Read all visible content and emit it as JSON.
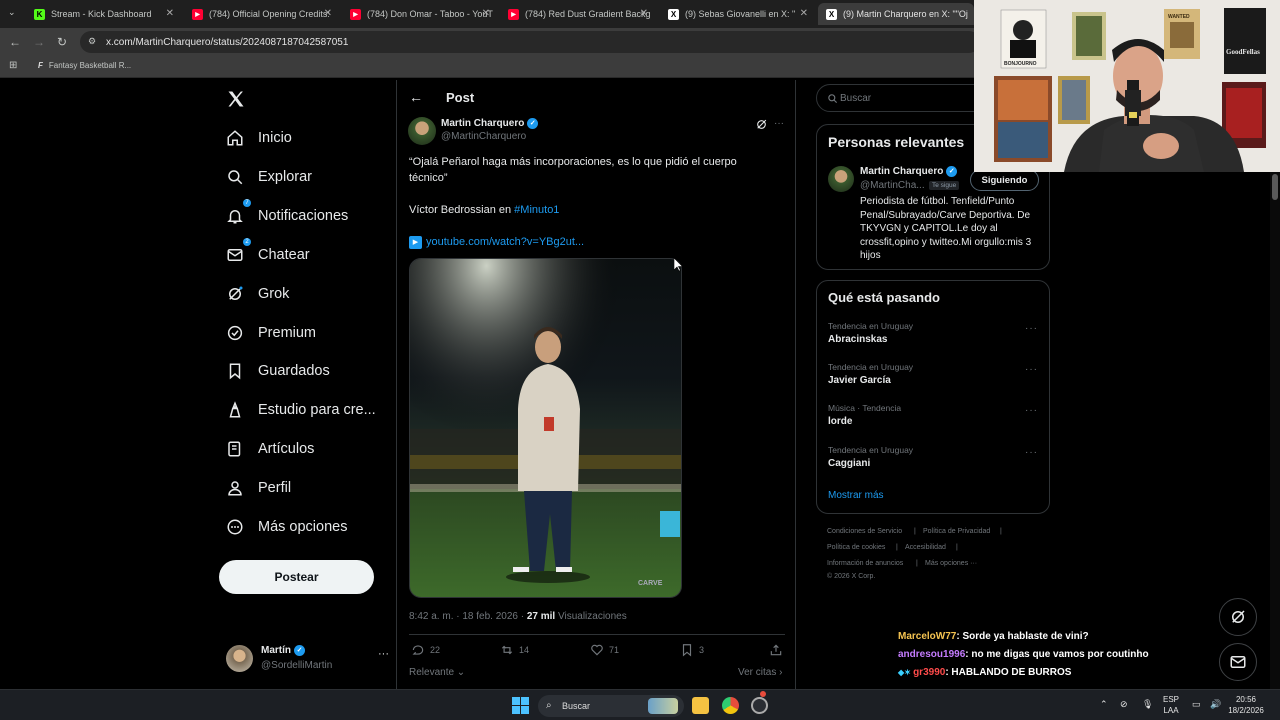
{
  "browser": {
    "tabs": [
      {
        "label": "Stream - Kick Dashboard",
        "favicon": "kick-icon",
        "color": "#53fc18",
        "glyph": "K"
      },
      {
        "label": "(784) Official Opening Credits: ",
        "favicon": "youtube-icon",
        "color": "#ff0033",
        "glyph": "▶"
      },
      {
        "label": "(784) Don Omar - Taboo - YouT",
        "favicon": "youtube-icon",
        "color": "#ff0033",
        "glyph": "▶"
      },
      {
        "label": "(784) Red Dust Gradient Backg",
        "favicon": "youtube-icon",
        "color": "#ff0033",
        "glyph": "▶"
      },
      {
        "label": "(9) Sebas Giovanelli en X: \"",
        "favicon": "x-icon",
        "color": "#ffffff",
        "glyph": "X"
      },
      {
        "label": "(9) Martin Charquero en X: \"\"Oj",
        "favicon": "x-icon",
        "color": "#ffffff",
        "glyph": "X"
      }
    ],
    "url": "x.com/MartinCharquero/status/2024087187042587051",
    "bookmark": "Fantasy Basketball R..."
  },
  "nav": {
    "items": [
      {
        "label": "Inicio",
        "icon": "home-icon"
      },
      {
        "label": "Explorar",
        "icon": "search-icon"
      },
      {
        "label": "Notificaciones",
        "icon": "bell-icon",
        "badge": "7"
      },
      {
        "label": "Chatear",
        "icon": "mail-icon",
        "badge": "2"
      },
      {
        "label": "Grok",
        "icon": "grok-icon"
      },
      {
        "label": "Premium",
        "icon": "premium-icon"
      },
      {
        "label": "Guardados",
        "icon": "bookmark-icon"
      },
      {
        "label": "Estudio para cre...",
        "icon": "studio-icon"
      },
      {
        "label": "Artículos",
        "icon": "article-icon"
      },
      {
        "label": "Perfil",
        "icon": "person-icon"
      },
      {
        "label": "Más opciones",
        "icon": "more-icon"
      }
    ],
    "post_button": "Postear",
    "account": {
      "name": "Martín",
      "handle": "@SordelliMartin"
    }
  },
  "post": {
    "header": "Post",
    "author": {
      "name": "Martin Charquero",
      "handle": "@MartinCharquero"
    },
    "text_line1": "“Ojalá Peñarol haga más incorporaciones, es lo que pidió el cuerpo",
    "text_line2": "técnico”",
    "text_line3_prefix": "Víctor Bedrossian en ",
    "hashtag": "#Minuto1",
    "link": "youtube.com/watch?v=YBg2ut...",
    "photo_watermark": "CARVE",
    "time": "8:42 a. m. · 18 feb. 2026 · ",
    "views_count": "27 mil",
    "views_label": " Visualizaciones",
    "replies": "22",
    "reposts": "14",
    "likes": "71",
    "bookmarks": "3",
    "sort_label": "Relevante",
    "quotes_label": "Ver citas"
  },
  "search": {
    "placeholder": "Buscar"
  },
  "relevant": {
    "title": "Personas relevantes",
    "name": "Martin Charquero",
    "handle": "@MartinCha...",
    "follows_you": "Te sigue",
    "follow_button": "Siguiendo",
    "bio": "Periodista de fútbol. Tenfield/Punto Penal/Subrayado/Carve Deportiva. De TKYVGN y CAPITOL.Le doy al crossfit,opino y twitteo.Mi orgullo:mis 3 hijos"
  },
  "trending": {
    "title": "Qué está pasando",
    "items": [
      {
        "category": "Tendencia en Uruguay",
        "name": "Abracinskas"
      },
      {
        "category": "Tendencia en Uruguay",
        "name": "Javier García"
      },
      {
        "category": "Música · Tendencia",
        "name": "lorde"
      },
      {
        "category": "Tendencia en Uruguay",
        "name": "Caggiani"
      }
    ],
    "show_more": "Mostrar más"
  },
  "footer": {
    "terms": "Condiciones de Servicio",
    "privacy": "Política de Privacidad",
    "cookies": "Política de cookies",
    "accessibility": "Accesibilidad",
    "ads": "Información de anuncios",
    "more": "Más opciones ···",
    "copyright": "© 2026 X Corp."
  },
  "webcam": {
    "poster1": "BONJOURNO",
    "poster2": "GoodFellas",
    "poster3": "WANTED"
  },
  "chat": [
    {
      "user": "MarceloW77",
      "user_color": "#f5c451",
      "message": ": Sorde ya hablaste de vini?"
    },
    {
      "user": "andresou1996",
      "user_color": "#c57cff",
      "message": ": no me digas que vamos por coutinho"
    },
    {
      "user": "gr3990",
      "user_color": "#ff4b4b",
      "message": ": HABLANDO DE BURROS"
    }
  ],
  "taskbar": {
    "search": "Buscar",
    "lang1": "ESP",
    "lang2": "LAA",
    "time": "20:56",
    "date": "18/2/2026"
  },
  "colors": {
    "accent": "#1d9bf0",
    "background": "#000000",
    "border": "#2f3336"
  }
}
